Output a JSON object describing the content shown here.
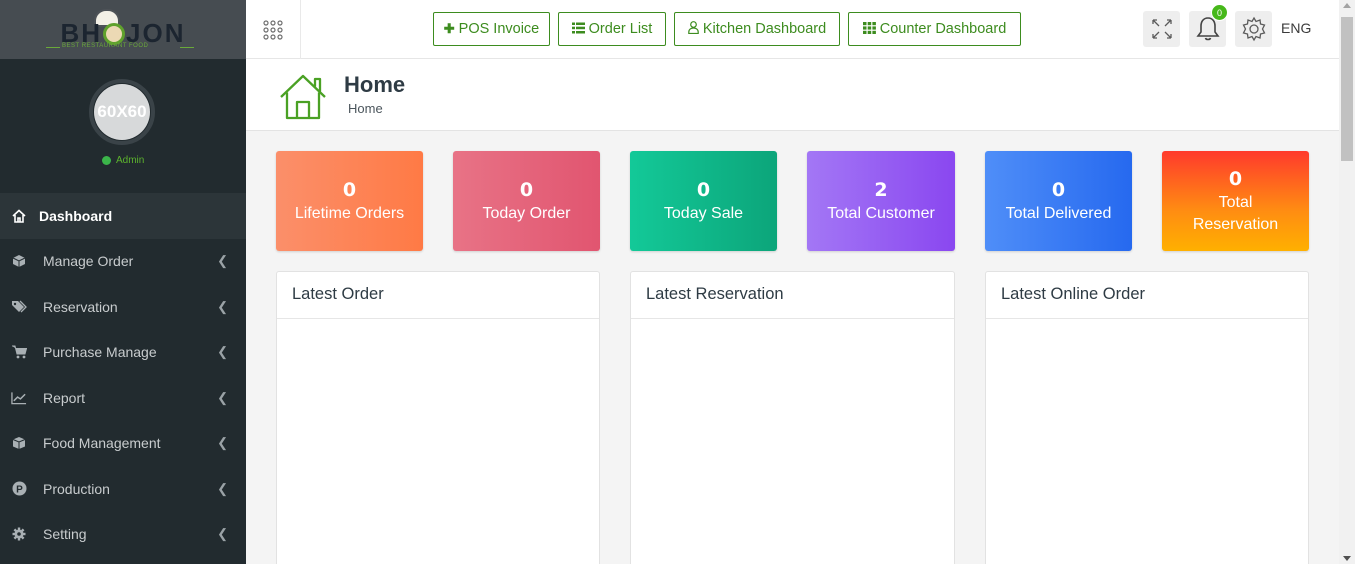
{
  "brand": {
    "logo_text": "BH",
    "logo_text_end": "JON",
    "tagline": "BEST RESTAURANT FOOD"
  },
  "profile": {
    "avatar_text": "60X60",
    "role": "Admin"
  },
  "sidebar": {
    "items": [
      {
        "label": "Dashboard",
        "icon": "home-icon",
        "active": true
      },
      {
        "label": "Manage Order",
        "icon": "cube-icon"
      },
      {
        "label": "Reservation",
        "icon": "tags-icon"
      },
      {
        "label": "Purchase Manage",
        "icon": "cart-icon"
      },
      {
        "label": "Report",
        "icon": "line-chart-icon"
      },
      {
        "label": "Food Management",
        "icon": "box-icon"
      },
      {
        "label": "Production",
        "icon": "production-icon"
      },
      {
        "label": "Setting",
        "icon": "gear-icon"
      }
    ]
  },
  "topbar": {
    "pos_invoice": "POS Invoice",
    "order_list": "Order List",
    "kitchen_dashboard": "Kitchen Dashboard",
    "counter_dashboard": "Counter Dashboard",
    "notification_count": "0",
    "language": "ENG",
    "accent_color": "#3d8c1f"
  },
  "header": {
    "title": "Home",
    "breadcrumb": "Home"
  },
  "stats": [
    {
      "value": "0",
      "label": "Lifetime Orders"
    },
    {
      "value": "0",
      "label": "Today Order"
    },
    {
      "value": "0",
      "label": "Today Sale"
    },
    {
      "value": "2",
      "label": "Total Customer"
    },
    {
      "value": "0",
      "label": "Total Delivered"
    },
    {
      "value": "0",
      "label": "Total Reservation"
    }
  ],
  "panels": {
    "latest_order": "Latest Order",
    "latest_reservation": "Latest Reservation",
    "latest_online_order": "Latest Online Order"
  }
}
